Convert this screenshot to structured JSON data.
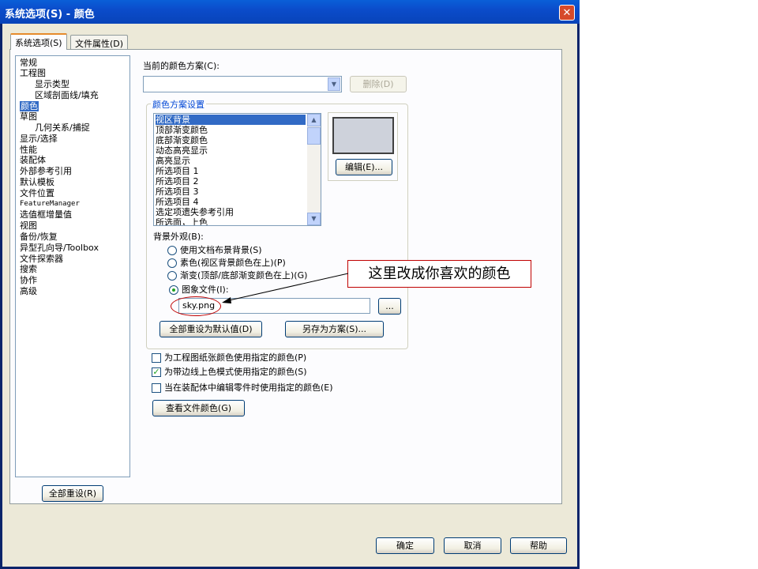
{
  "window": {
    "title": "系统选项(S) - 颜色",
    "close_glyph": "✕"
  },
  "tabs": [
    {
      "label": "系统选项(S)",
      "active": true
    },
    {
      "label": "文件属性(D)",
      "active": false
    }
  ],
  "tree": {
    "items": [
      {
        "label": "常规"
      },
      {
        "label": "工程图"
      },
      {
        "label": "显示类型"
      },
      {
        "label": "区域剖面线/填充"
      },
      {
        "label": "颜色",
        "selected": true
      },
      {
        "label": "草图"
      },
      {
        "label": "几何关系/捕捉"
      },
      {
        "label": "显示/选择"
      },
      {
        "label": "性能"
      },
      {
        "label": "装配体"
      },
      {
        "label": "外部参考引用"
      },
      {
        "label": "默认模板"
      },
      {
        "label": "文件位置"
      },
      {
        "label": "FeatureManager"
      },
      {
        "label": "选值框增量值"
      },
      {
        "label": "视图"
      },
      {
        "label": "备份/恢复"
      },
      {
        "label": "异型孔向导/Toolbox"
      },
      {
        "label": "文件探索器"
      },
      {
        "label": "搜索"
      },
      {
        "label": "协作"
      },
      {
        "label": "高级"
      }
    ],
    "reset_all_label": "全部重设(R)"
  },
  "color_scheme": {
    "current_label": "当前的颜色方案(C):",
    "current_value": "",
    "delete_label": "删除(D)"
  },
  "scheme_settings": {
    "group_title": "颜色方案设置",
    "items": [
      {
        "label": "视区背景",
        "selected": true
      },
      {
        "label": "顶部渐变颜色"
      },
      {
        "label": "底部渐变颜色"
      },
      {
        "label": "动态高亮显示"
      },
      {
        "label": "高亮显示"
      },
      {
        "label": "所选项目 1"
      },
      {
        "label": "所选项目 2"
      },
      {
        "label": "所选项目 3"
      },
      {
        "label": "所选项目 4"
      },
      {
        "label": "选定项遗失参考引用"
      },
      {
        "label": "所选面，上色"
      }
    ],
    "swatch_color": "#ced2db",
    "edit_label": "编辑(E)..."
  },
  "background": {
    "label": "背景外观(B):",
    "options": [
      {
        "label": "使用文档布景背景(S)",
        "checked": false
      },
      {
        "label": "素色(视区背景颜色在上)(P)",
        "checked": false
      },
      {
        "label": "渐变(顶部/底部渐变颜色在上)(G)",
        "checked": true
      },
      {
        "label": "图象文件(I):",
        "checked": true
      }
    ],
    "image_file": "sky.png",
    "browse_label": "...",
    "reset_defaults_label": "全部重设为默认值(D)",
    "save_as_label": "另存为方案(S)..."
  },
  "checkboxes": [
    {
      "label": "为工程图纸张颜色使用指定的颜色(P)",
      "checked": false
    },
    {
      "label": "为带边线上色模式使用指定的颜色(S)",
      "checked": true
    },
    {
      "label": "当在装配体中编辑零件时使用指定的颜色(E)",
      "checked": false
    }
  ],
  "view_doc_colors_label": "查看文件颜色(G)",
  "annotation": {
    "text": "这里改成你喜欢的颜色",
    "color": "#c00000"
  },
  "footer": {
    "ok_label": "确定",
    "cancel_label": "取消",
    "help_label": "帮助"
  }
}
